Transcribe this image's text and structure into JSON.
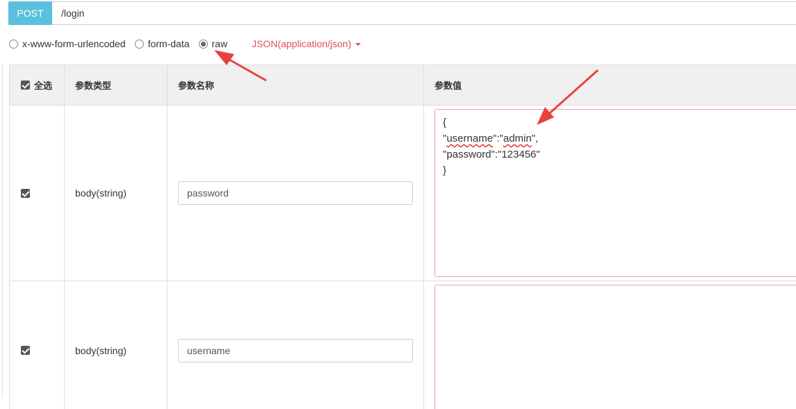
{
  "request": {
    "method": "POST",
    "path": "/login"
  },
  "body_types": {
    "options": [
      "x-www-form-urlencoded",
      "form-data",
      "raw"
    ],
    "selected": "raw",
    "content_type": "JSON(application/json)"
  },
  "table": {
    "headers": {
      "select_all": "全选",
      "param_type": "参数类型",
      "param_name": "参数名称",
      "param_value": "参数值"
    },
    "rows": [
      {
        "checked": true,
        "type": "body(string)",
        "name": "password",
        "value_lines": [
          "{",
          "\"username\":\"admin\",",
          "\"password\":\"123456\"",
          "}"
        ]
      },
      {
        "checked": true,
        "type": "body(string)",
        "name": "username",
        "value": ""
      }
    ]
  },
  "colors": {
    "method_bg": "#5bc0de",
    "accent_red": "#d9534f",
    "annotation_arrow": "#e8423f"
  }
}
